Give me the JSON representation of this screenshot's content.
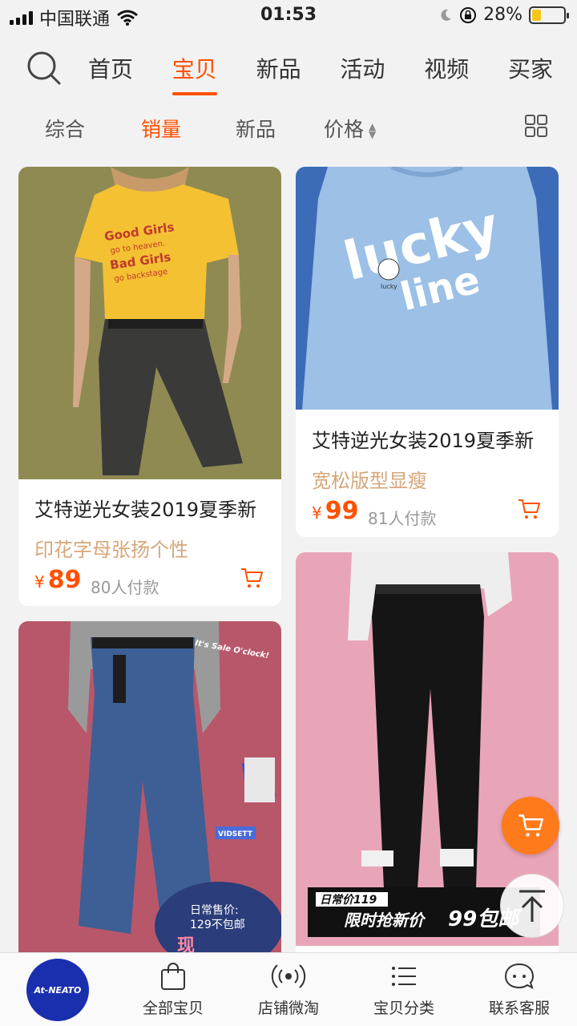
{
  "status_bar": {
    "carrier": "中国联通",
    "time": "01:53",
    "battery_percent": "28%",
    "battery_level": 0.28
  },
  "top_nav": {
    "tabs": [
      {
        "label": "首页",
        "active": false
      },
      {
        "label": "宝贝",
        "active": true
      },
      {
        "label": "新品",
        "active": false
      },
      {
        "label": "活动",
        "active": false
      },
      {
        "label": "视频",
        "active": false
      },
      {
        "label": "买家",
        "active": false
      }
    ]
  },
  "sort_bar": {
    "comprehensive": "综合",
    "sales": "销量",
    "new": "新品",
    "price": "价格"
  },
  "products": [
    {
      "title": "艾特逆光女装2019夏季新",
      "subtitle": "印花字母张扬个性",
      "currency": "¥",
      "price": "89",
      "sold": "80人付款",
      "image_text": [
        "Good Girls",
        "go to heaven.",
        "Bad Girls",
        "go backstage"
      ]
    },
    {
      "title": "艾特逆光女装2019夏季新",
      "subtitle": "宽松版型显瘦",
      "currency": "¥",
      "price": "99",
      "sold": "81人付款",
      "image_text": [
        "lucky",
        "line",
        "lucky"
      ]
    },
    {
      "image_text": [
        "It's Sale O'clock!",
        "VIDSETT",
        "日常售价:",
        "129不包邮",
        "现"
      ]
    },
    {
      "image_text": [
        "日常价119",
        "限时抢新价",
        "99包邮"
      ]
    }
  ],
  "bottom_bar": {
    "logo_text": "At-NEATO",
    "items": [
      {
        "label": "全部宝贝",
        "icon": "bag-icon"
      },
      {
        "label": "店铺微淘",
        "icon": "signal-icon"
      },
      {
        "label": "宝贝分类",
        "icon": "list-icon"
      },
      {
        "label": "联系客服",
        "icon": "chat-icon"
      }
    ]
  },
  "colors": {
    "accent": "#ff5000",
    "subtitle": "#d6a77a",
    "logo_bg": "#1a2fae"
  }
}
